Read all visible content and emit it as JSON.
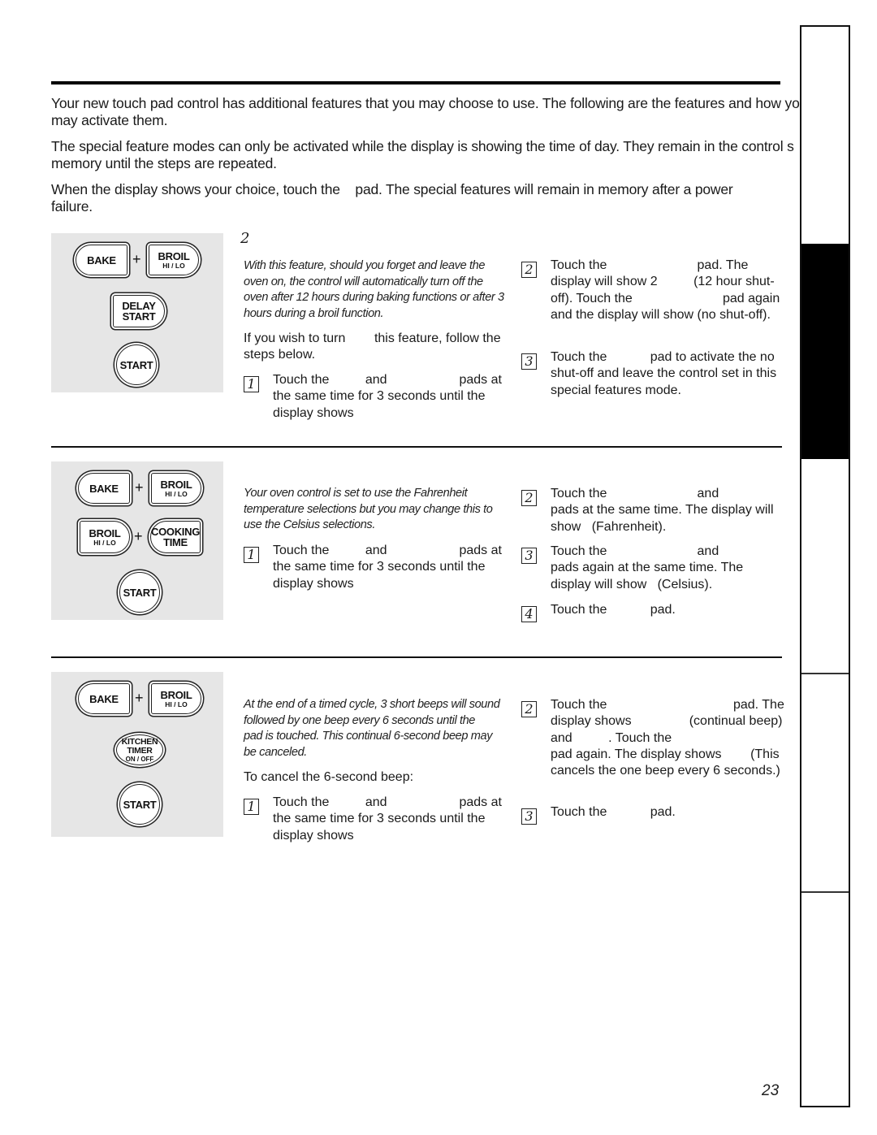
{
  "intro": {
    "p1": "Your new touch pad control has additional features that you may choose to use. The following are the features and how you may activate them.",
    "p2": "The special feature modes can only be activated while the display is showing the time of day. They remain in the control s memory until the steps are repeated.",
    "p3": "When the display shows your choice, touch the    pad. The special features will remain in memory after a power failure."
  },
  "sections": [
    {
      "heading_glyph": "2",
      "pads": {
        "bake": "BAKE",
        "plus": "+",
        "broil": "BROIL",
        "broil_sub": "HI / LO",
        "delay_1": "DELAY",
        "delay_2": "START",
        "start": "START"
      },
      "description": "With this feature, should you forget and leave the oven on, the control will automatically turn off the oven after 12 hours during baking functions or after 3 hours during a broil function.",
      "subtext": "If you wish to turn        this feature, follow the steps below.",
      "steps": [
        {
          "num": "1",
          "text": "Touch the          and                    pads at the same time for 3 seconds until the display shows"
        },
        {
          "num": "2",
          "text": "Touch the                         pad. The display will show 2          (12 hour shut-off). Touch the                         pad again and the display will show (no shut-off)."
        },
        {
          "num": "3",
          "text": "Touch the            pad to activate the no shut-off and leave the control set in this special features mode."
        }
      ]
    },
    {
      "pads": {
        "bake": "BAKE",
        "plus": "+",
        "broil": "BROIL",
        "broil_sub": "HI / LO",
        "broil2": "BROIL",
        "broil2_sub": "HI / LO",
        "plus2": "+",
        "cooking_1": "COOKING",
        "cooking_2": "TIME",
        "start": "START"
      },
      "description": "Your oven control is set to use the Fahrenheit temperature selections but you may change this to use the Celsius selections.",
      "steps": [
        {
          "num": "1",
          "text": "Touch the          and                    pads at the same time for 3 seconds until the display shows"
        },
        {
          "num": "2",
          "text": "Touch the                         and             pads at the same time. The display will show   (Fahrenheit)."
        },
        {
          "num": "3",
          "text": "Touch the                         and             pads again at the same time. The display will show   (Celsius)."
        },
        {
          "num": "4",
          "text": "Touch the            pad."
        }
      ]
    },
    {
      "pads": {
        "bake": "BAKE",
        "plus": "+",
        "broil": "BROIL",
        "broil_sub": "HI / LO",
        "kitchen_1": "KITCHEN",
        "kitchen_2": "TIMER",
        "kitchen_3": "ON / OFF",
        "start": "START"
      },
      "description": "At the end of a timed cycle, 3 short beeps will sound followed by one beep every 6 seconds until the                       pad is touched. This continual 6-second beep may be canceled.",
      "subtext": "To cancel the 6-second beep:",
      "steps": [
        {
          "num": "1",
          "text": "Touch the          and                    pads at the same time for 3 seconds until the display shows"
        },
        {
          "num": "2",
          "text": "Touch the                                   pad. The display shows                (continual beep) and          . Touch the                                   pad again. The display shows        (This cancels the one beep every 6 seconds.)"
        },
        {
          "num": "3",
          "text": "Touch the            pad."
        }
      ]
    }
  ],
  "side_tab": {
    "active_section": 2,
    "section_count": 5
  },
  "page_number": "23"
}
